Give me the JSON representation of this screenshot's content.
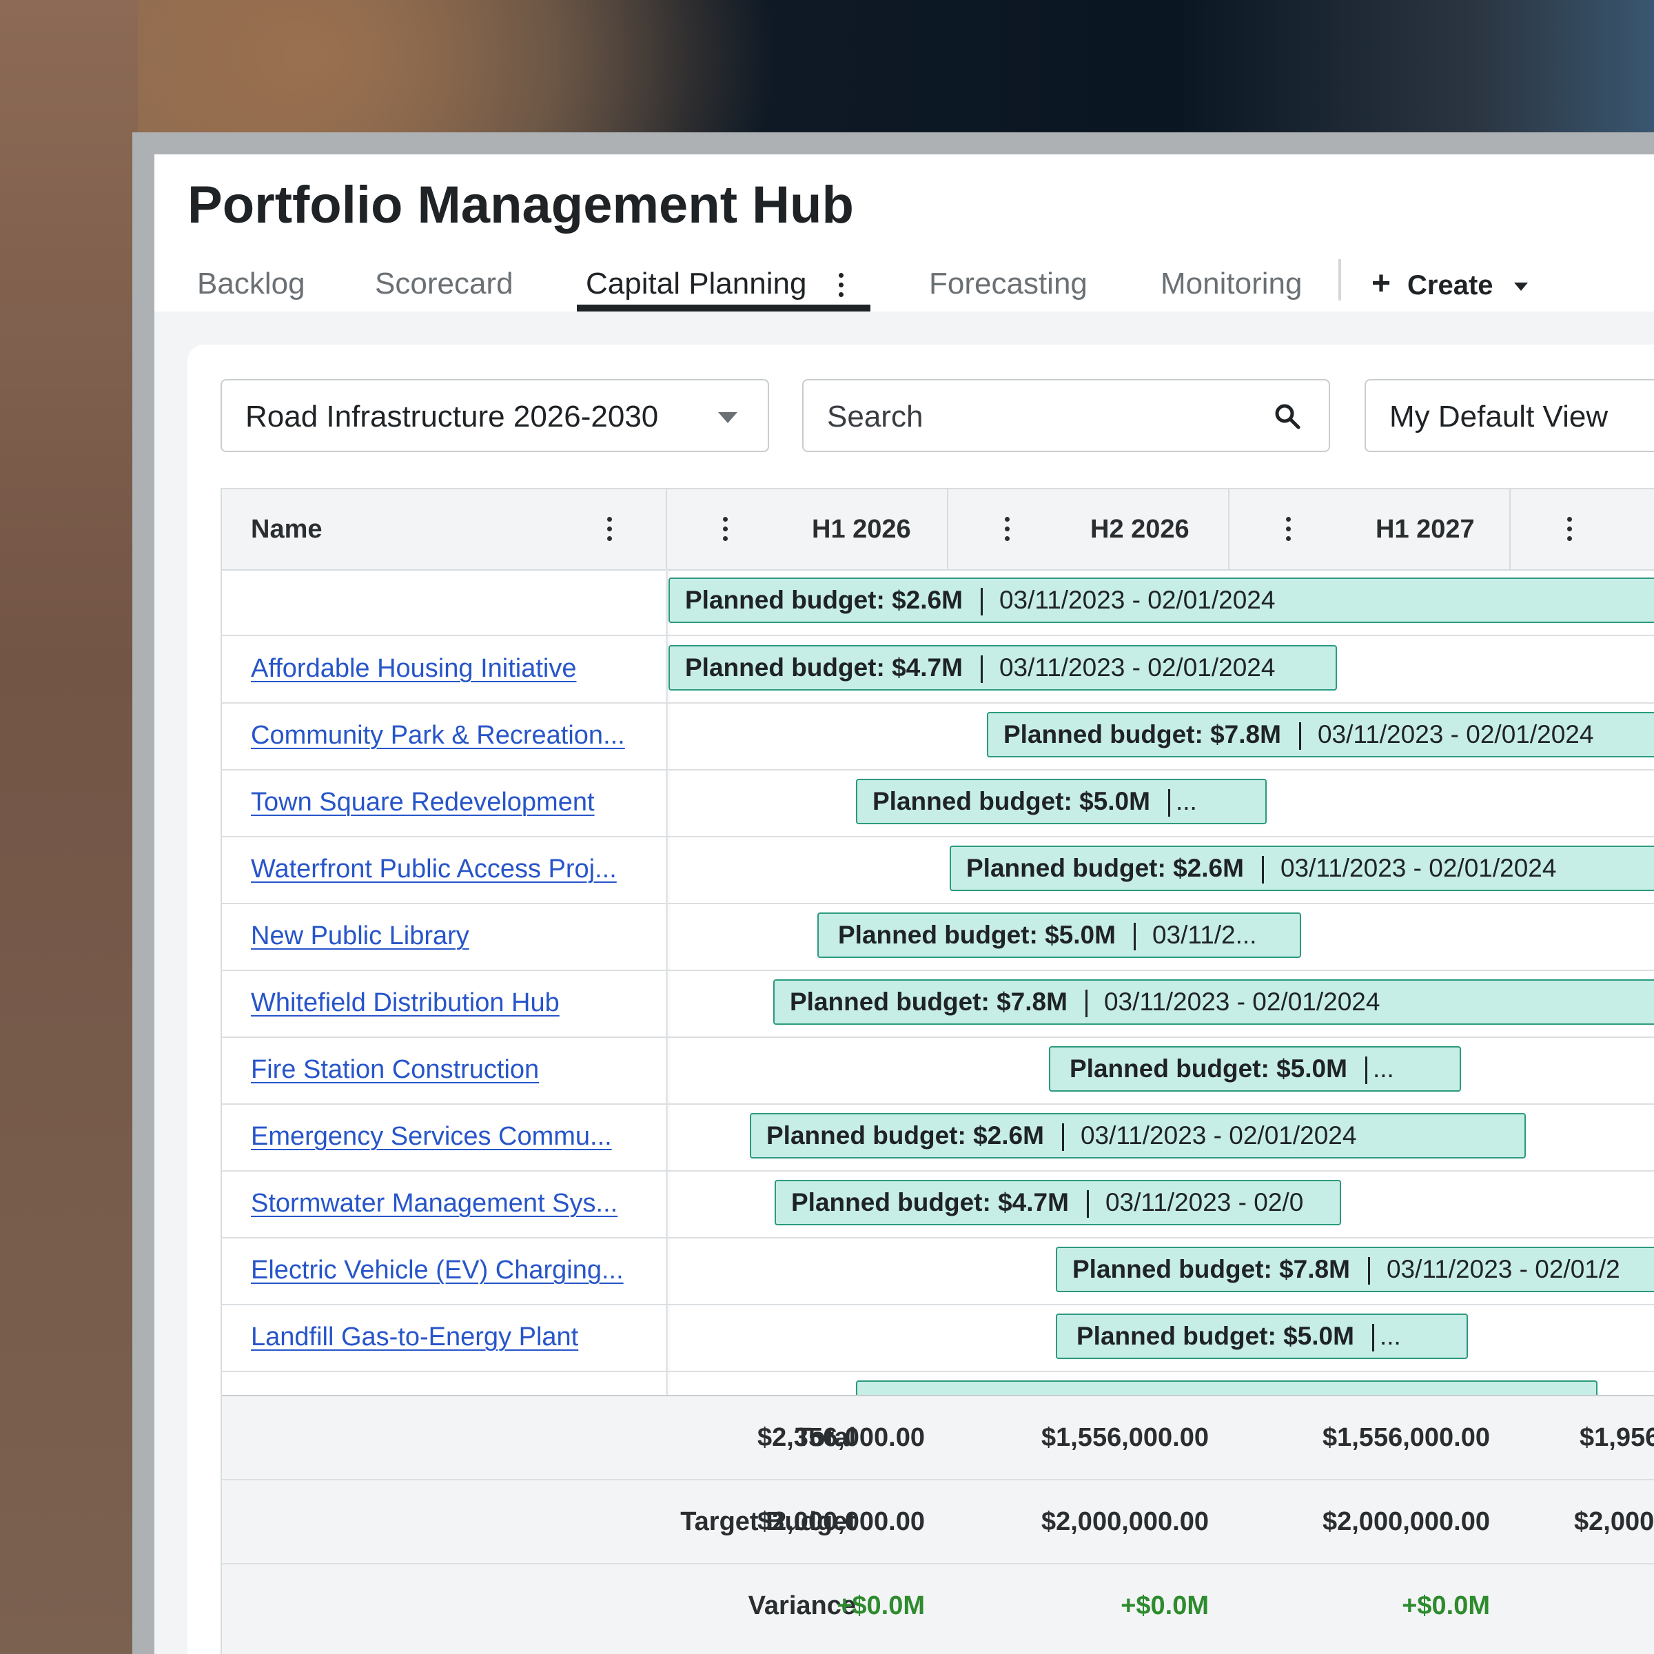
{
  "app": {
    "title": "Portfolio Management Hub"
  },
  "tabs": [
    {
      "label": "Backlog",
      "active": false
    },
    {
      "label": "Scorecard",
      "active": false
    },
    {
      "label": "Capital Planning",
      "active": true
    },
    {
      "label": "Forecasting",
      "active": false
    },
    {
      "label": "Monitoring",
      "active": false
    }
  ],
  "create": {
    "label": "Create"
  },
  "filters": {
    "portfolio": "Road Infrastructure 2026-2030",
    "search_placeholder": "Search",
    "view": "My Default View"
  },
  "grid": {
    "columns": [
      "Name",
      "H1 2026",
      "H2 2026",
      "H1 2027"
    ],
    "rows": [
      {
        "name": "",
        "budget": "Planned budget: $2.6M",
        "dates": "03/11/2023 - 02/01/2024"
      },
      {
        "name": "Affordable Housing Initiative",
        "budget": "Planned budget: $4.7M",
        "dates": "03/11/2023 - 02/01/2024"
      },
      {
        "name": "Community Park & Recreation...",
        "budget": "Planned budget: $7.8M",
        "dates": "03/11/2023 - 02/01/2024"
      },
      {
        "name": "Town Square Redevelopment",
        "budget": "Planned budget: $5.0M",
        "dates": "..."
      },
      {
        "name": "Waterfront Public Access Proj...",
        "budget": "Planned budget: $2.6M",
        "dates": "03/11/2023 - 02/01/2024"
      },
      {
        "name": "New Public Library",
        "budget": "Planned budget: $5.0M",
        "dates": "03/11/2..."
      },
      {
        "name": "Whitefield Distribution Hub",
        "budget": "Planned budget: $7.8M",
        "dates": "03/11/2023 - 02/01/2024"
      },
      {
        "name": "Fire Station Construction",
        "budget": "Planned budget: $5.0M",
        "dates": "..."
      },
      {
        "name": "Emergency Services Commu...",
        "budget": "Planned budget: $2.6M",
        "dates": "03/11/2023 - 02/01/2024"
      },
      {
        "name": "Stormwater Management Sys...",
        "budget": "Planned budget: $4.7M",
        "dates": "03/11/2023 - 02/0"
      },
      {
        "name": "Electric Vehicle (EV) Charging...",
        "budget": "Planned budget: $7.8M",
        "dates": "03/11/2023 - 02/01/2"
      },
      {
        "name": "Landfill Gas-to-Energy Plant",
        "budget": "Planned budget: $5.0M",
        "dates": "..."
      }
    ]
  },
  "footer": {
    "total": {
      "label": "Total",
      "values": [
        "$2,356,000.00",
        "$1,556,000.00",
        "$1,556,000.00",
        "$1,956"
      ]
    },
    "target": {
      "label": "Target Budget",
      "values": [
        "$2,000,000.00",
        "$2,000,000.00",
        "$2,000,000.00",
        "$2,000"
      ]
    },
    "variance": {
      "label": "Variance",
      "values": [
        "+$0.0M",
        "+$0.0M",
        "+$0.0M"
      ]
    }
  },
  "colors": {
    "bar_fill": "#c6ede6",
    "bar_border": "#2c9a7e",
    "link": "#2755c9",
    "variance_positive": "#2e8b2e"
  },
  "icons": [
    "vertical-dots-icon",
    "search-icon",
    "plus-icon",
    "caret-down-icon"
  ]
}
